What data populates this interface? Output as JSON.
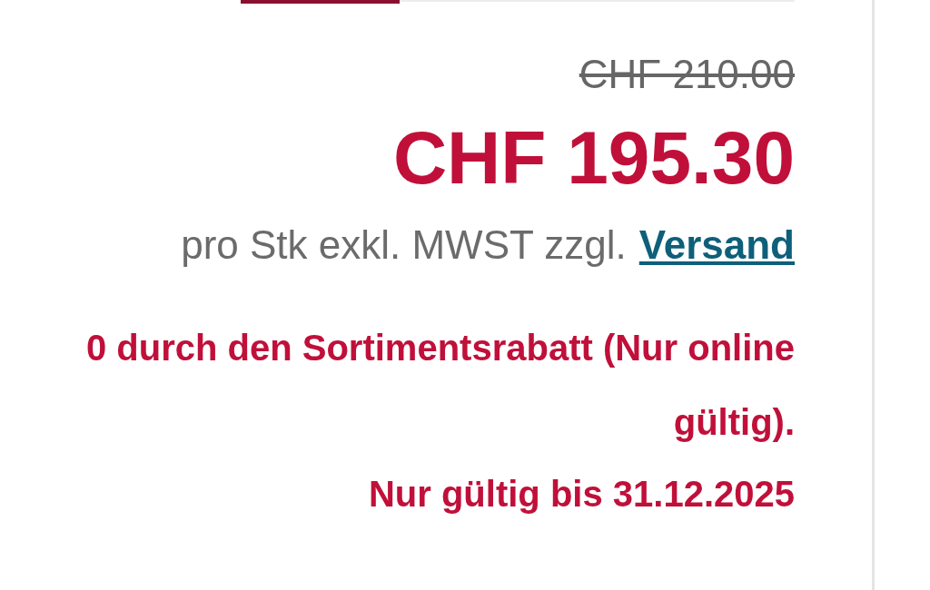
{
  "price": {
    "old": "CHF 210.00",
    "current": "CHF 195.30",
    "note": "pro Stk exkl. MWST zzgl.",
    "shipping_link": "Versand"
  },
  "discount": {
    "message": "0 durch den Sortimentsrabatt (Nur online gültig).",
    "validity": "Nur gültig bis 31.12.2025"
  }
}
